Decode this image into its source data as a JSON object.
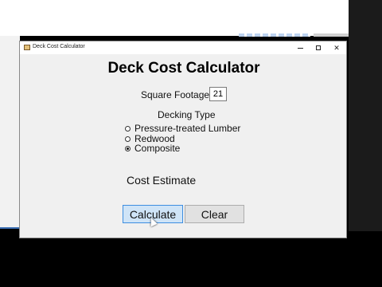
{
  "window": {
    "title": "Deck Cost Calculator",
    "minimize_glyph": "minimize-icon",
    "maximize_glyph": "maximize-icon",
    "close_glyph": "✕"
  },
  "main": {
    "heading": "Deck Cost Calculator",
    "square_footage": {
      "label": "Square Footage:",
      "value": "21"
    },
    "decking": {
      "title": "Decking Type",
      "options": [
        {
          "label": "Pressure-treated Lumber",
          "checked": false
        },
        {
          "label": "Redwood",
          "checked": false
        },
        {
          "label": "Composite",
          "checked": true
        }
      ]
    },
    "cost_label": "Cost Estimate",
    "buttons": {
      "calculate": "Calculate",
      "clear": "Clear"
    }
  },
  "colors": {
    "primary_button_bg": "#cfe4f7",
    "primary_button_border": "#3d8ee0"
  }
}
